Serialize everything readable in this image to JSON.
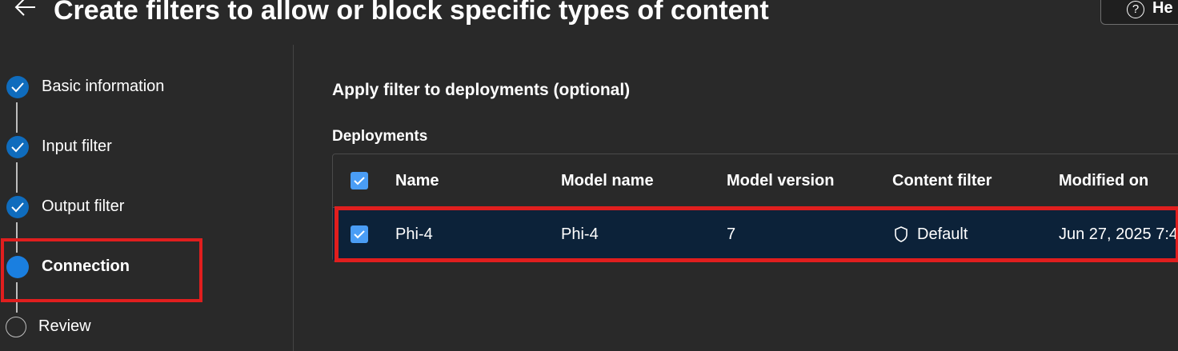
{
  "header": {
    "title": "Create filters to allow or block specific types of content",
    "help_label": "He"
  },
  "steps": [
    {
      "label": "Basic information",
      "state": "completed"
    },
    {
      "label": "Input filter",
      "state": "completed"
    },
    {
      "label": "Output filter",
      "state": "completed"
    },
    {
      "label": "Connection",
      "state": "current"
    },
    {
      "label": "Review",
      "state": "pending"
    }
  ],
  "main": {
    "section_title": "Apply filter to deployments (optional)",
    "deployments_label": "Deployments"
  },
  "table": {
    "columns": [
      "Name",
      "Model name",
      "Model version",
      "Content filter",
      "Modified on"
    ],
    "rows": [
      {
        "name": "Phi-4",
        "model_name": "Phi-4",
        "model_version": "7",
        "content_filter": "Default",
        "modified_on": "Jun 27, 2025 7:4",
        "selected": true
      }
    ]
  },
  "colors": {
    "accent": "#0f6cbd",
    "highlight": "#e01e1e",
    "selected_row": "#0c2239"
  }
}
